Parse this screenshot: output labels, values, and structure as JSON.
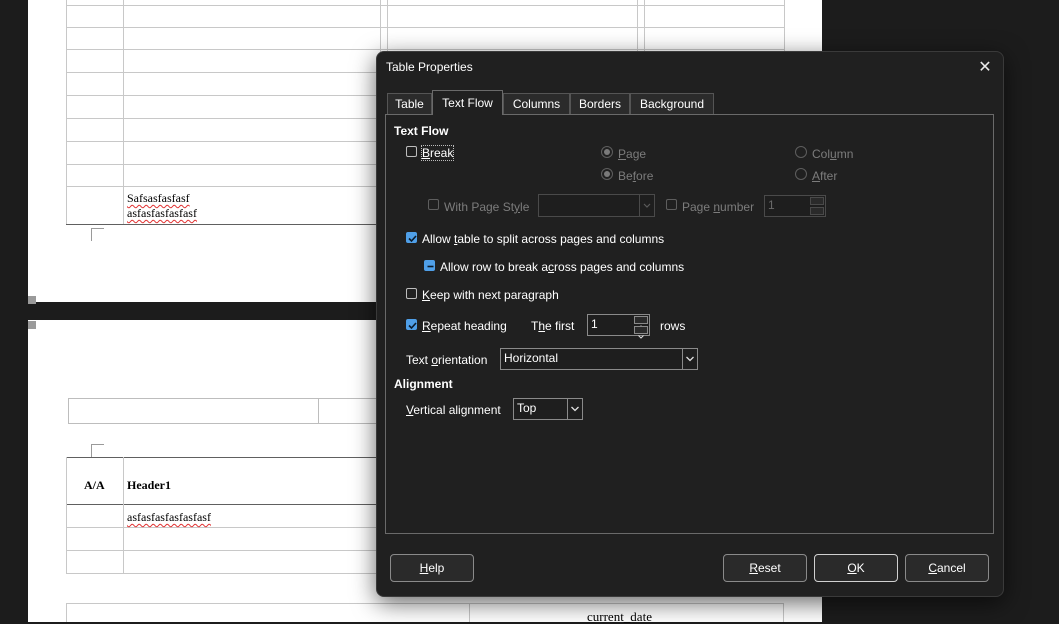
{
  "document": {
    "cell_text_line1": "Safsasfasfasf",
    "cell_text_line2": "asfasfasfasfasf",
    "header_col1": "A/A",
    "header_col2": "Header1",
    "row_text": "asfasfasfasfasfasf",
    "footer_text": "current_date"
  },
  "dialog": {
    "title": "Table Properties",
    "tabs": [
      {
        "label": "Table",
        "active": false
      },
      {
        "label": "Text Flow",
        "active": true
      },
      {
        "label": "Columns",
        "active": false
      },
      {
        "label": "Borders",
        "active": false
      },
      {
        "label": "Background",
        "active": false
      }
    ],
    "text_flow": {
      "section_title": "Text Flow",
      "break": {
        "label": "Break",
        "checked": false
      },
      "page_radio": {
        "label": "Page",
        "selected": true,
        "enabled": false
      },
      "column_radio": {
        "label": "Column",
        "selected": false,
        "enabled": false
      },
      "before_radio": {
        "label": "Before",
        "selected": true,
        "enabled": false
      },
      "after_radio": {
        "label": "After",
        "selected": false,
        "enabled": false
      },
      "with_page_style": {
        "label": "With Page Style",
        "checked": false,
        "enabled": false,
        "value": ""
      },
      "page_number": {
        "label": "Page number",
        "checked": false,
        "enabled": false,
        "value": "1"
      },
      "allow_split": {
        "label": "Allow table to split across pages and columns",
        "checked": true
      },
      "allow_row_break": {
        "label": "Allow row to break across pages and columns",
        "state": "indeterminate"
      },
      "keep_with_next": {
        "label": "Keep with next paragraph",
        "checked": false
      },
      "repeat_heading": {
        "label": "Repeat heading",
        "checked": true
      },
      "the_first": {
        "label": "The first",
        "value": "1",
        "suffix": "rows"
      },
      "text_orientation": {
        "label": "Text orientation",
        "value": "Horizontal"
      }
    },
    "alignment": {
      "section_title": "Alignment",
      "vertical_alignment": {
        "label": "Vertical alignment",
        "value": "Top"
      }
    },
    "buttons": {
      "help": "Help",
      "reset": "Reset",
      "ok": "OK",
      "cancel": "Cancel"
    }
  }
}
